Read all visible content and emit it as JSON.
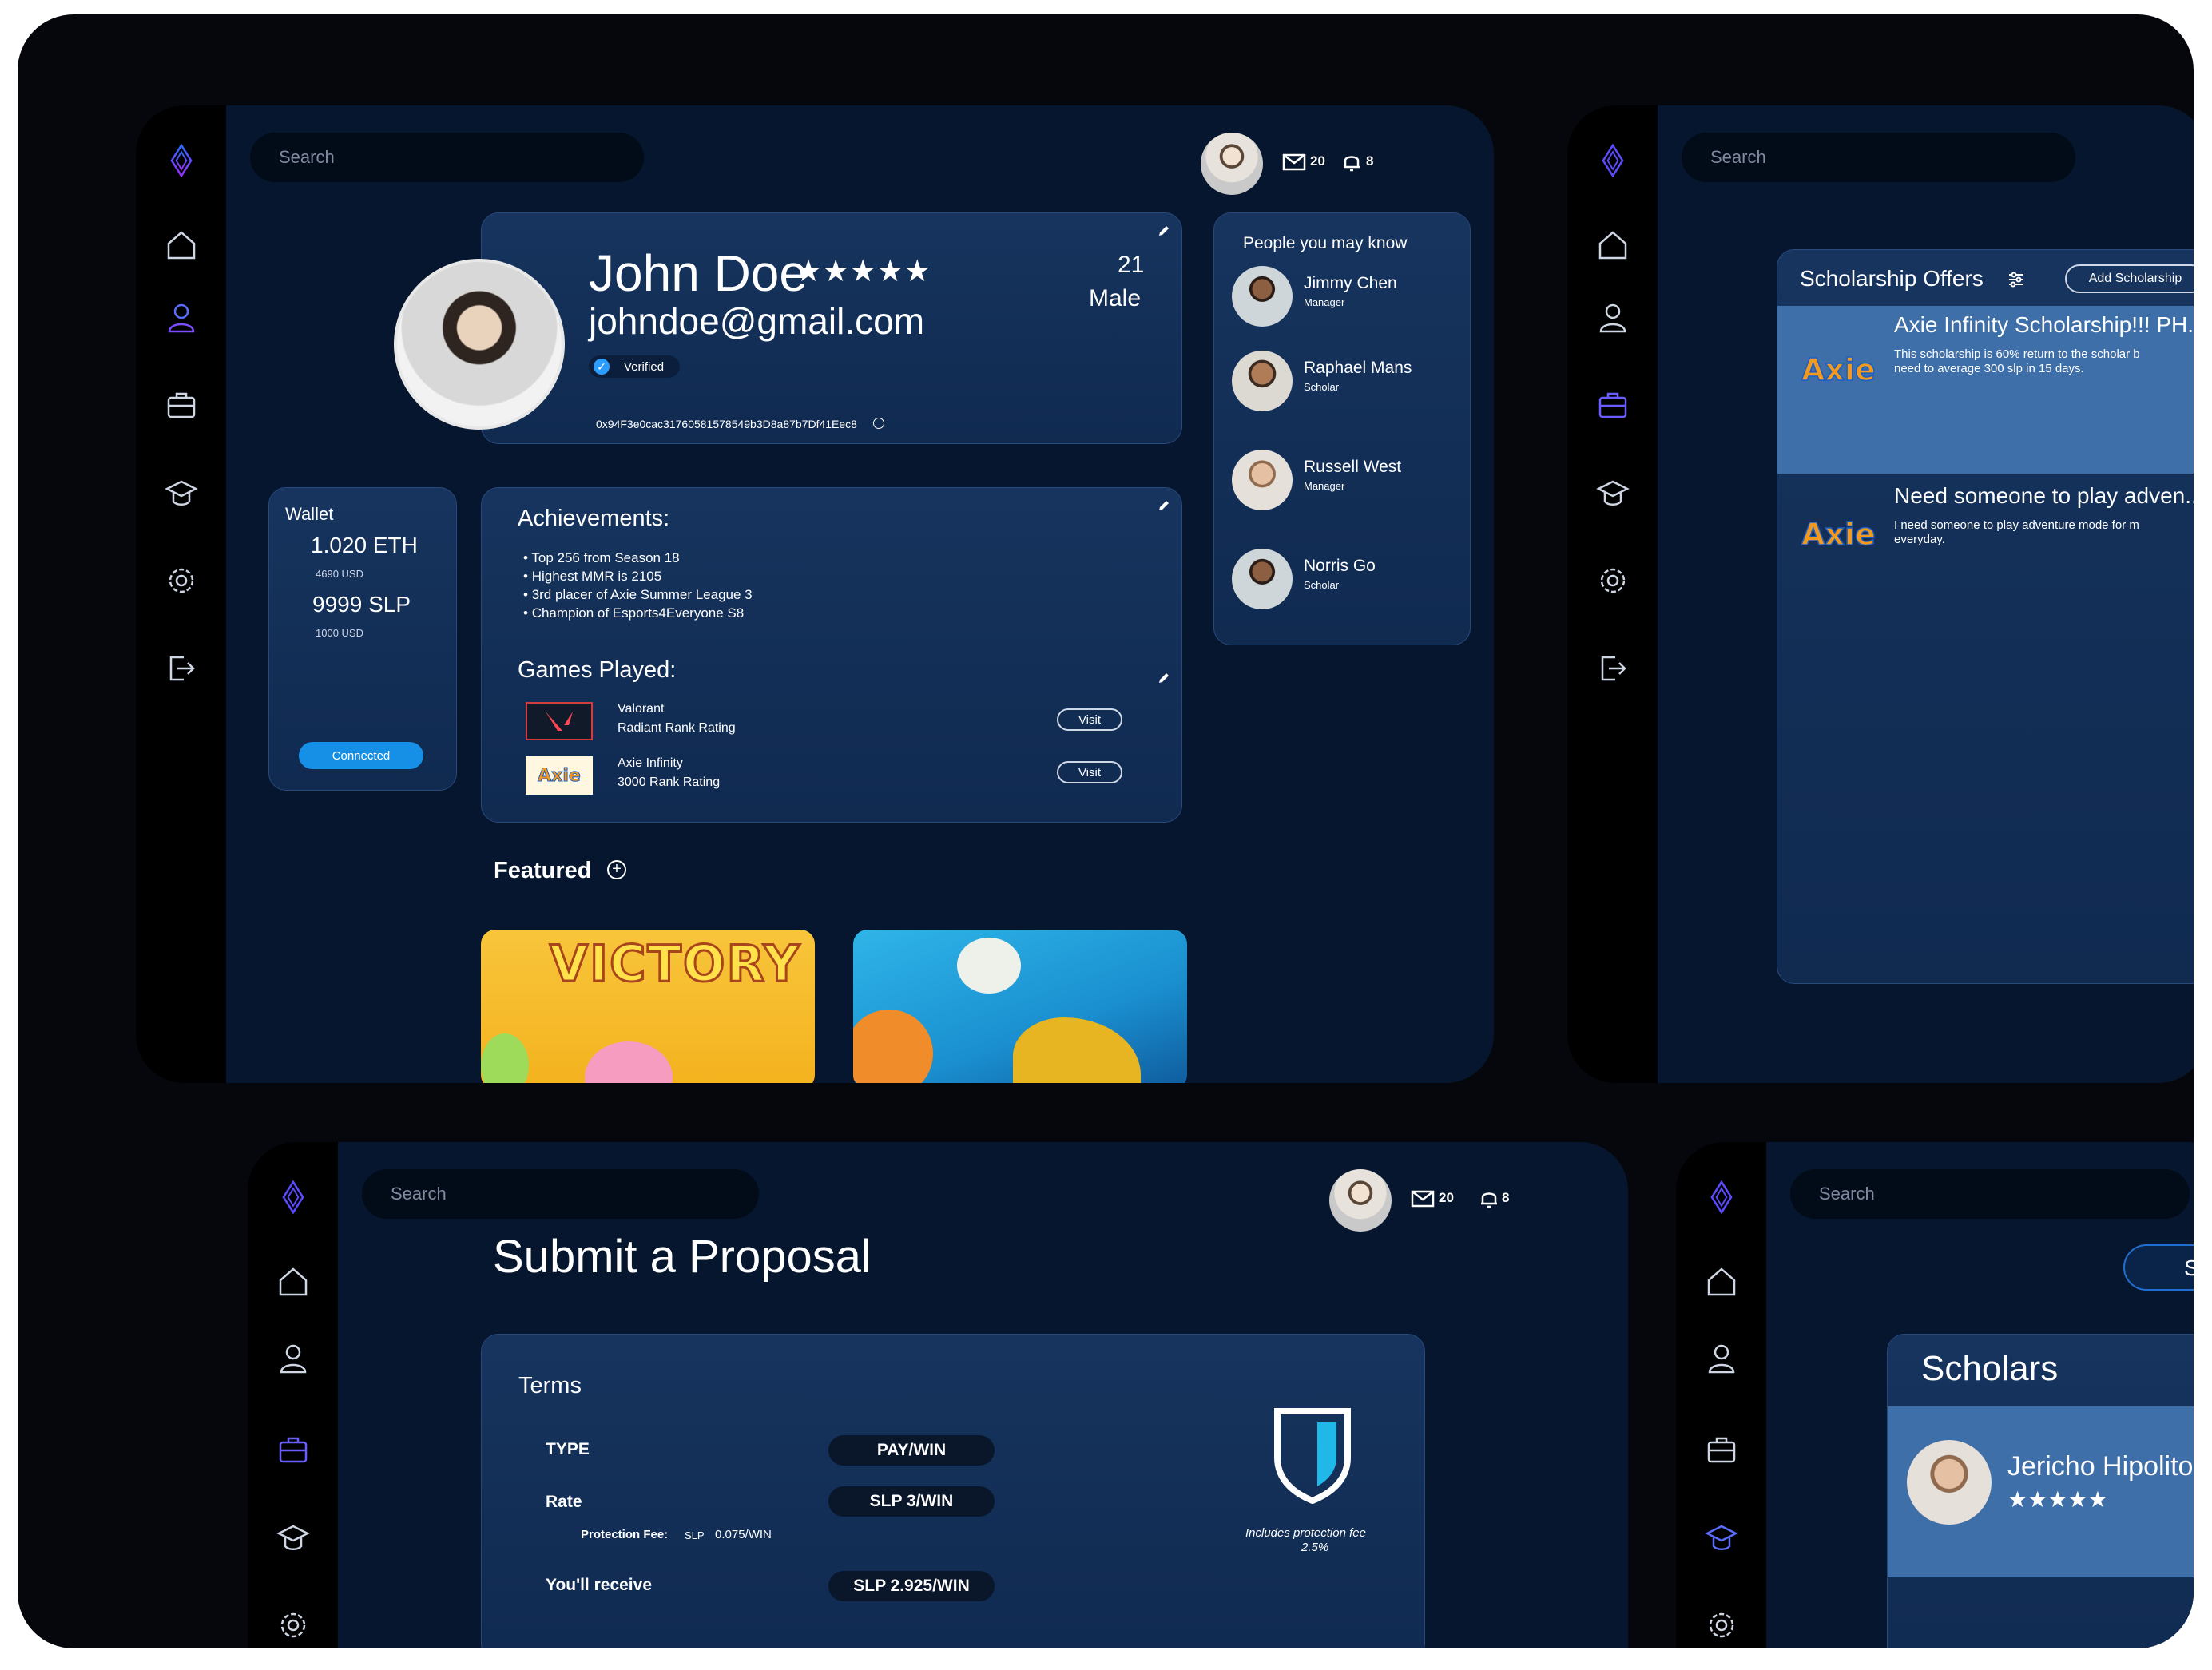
{
  "search_placeholder": "Search",
  "header": {
    "messages_count": "20",
    "notifications_count": "8"
  },
  "profile": {
    "name": "John Doe",
    "rating_stars": "★★★★★",
    "email": "johndoe@gmail.com",
    "verified_label": "Verified",
    "age": "21",
    "gender": "Male",
    "wallet_address": "0x94F3e0cac31760581578549b3D8a87b7Df41Eec8"
  },
  "wallet": {
    "title": "Wallet",
    "eth": "1.020 ETH",
    "eth_usd": "4690 USD",
    "slp": "9999 SLP",
    "slp_usd": "1000 USD",
    "button": "Connected"
  },
  "achievements": {
    "title": "Achievements:",
    "items": [
      "Top 256 from Season 18",
      "Highest MMR is 2105",
      "3rd placer of Axie Summer League 3",
      "Champion of Esports4Everyone S8"
    ]
  },
  "games": {
    "title": "Games Played:",
    "items": [
      {
        "name": "Valorant",
        "rating": "Radiant Rank Rating",
        "button": "Visit"
      },
      {
        "name": "Axie Infinity",
        "rating": "3000 Rank Rating",
        "button": "Visit"
      }
    ]
  },
  "featured": {
    "title": "Featured",
    "cards": [
      "VICTORY",
      ""
    ]
  },
  "people": {
    "title": "People you may know",
    "items": [
      {
        "name": "Jimmy Chen",
        "role": "Manager"
      },
      {
        "name": "Raphael Mans",
        "role": "Scholar"
      },
      {
        "name": "Russell West",
        "role": "Manager"
      },
      {
        "name": "Norris Go",
        "role": "Scholar"
      }
    ]
  },
  "scholarship": {
    "title": "Scholarship Offers",
    "add_button": "Add Scholarship",
    "offers": [
      {
        "title": "Axie Infinity Scholarship!!! PH...",
        "desc_line1": "This scholarship is 60% return to the scholar b",
        "desc_line2": "need to average 300 slp in 15 days.",
        "logo": "Axie"
      },
      {
        "title": "Need someone to play adven...",
        "desc_line1": "I need someone to play adventure mode for m",
        "desc_line2": "everyday.",
        "logo": "Axie"
      }
    ]
  },
  "proposal": {
    "title": "Submit a Proposal",
    "terms_title": "Terms",
    "type_label": "TYPE",
    "type_value": "PAY/WIN",
    "rate_label": "Rate",
    "rate_value": "SLP 3/WIN",
    "fee_label": "Protection Fee:",
    "fee_unit": "SLP",
    "fee_value": "0.075/WIN",
    "receive_label": "You'll receive",
    "receive_value": "SLP 2.925/WIN",
    "shield_text1": "Includes protection fee",
    "shield_text2": "2.5%"
  },
  "scholars": {
    "title": "Scholars",
    "tab_label": "S",
    "member_name": "Jericho Hipolito",
    "member_stars": "★★★★★"
  },
  "colors": {
    "accent": "#3b6cff",
    "brand_gradient": [
      "#2a6bff",
      "#9b2cff"
    ],
    "button": "#1590e6",
    "card": "#16345e"
  }
}
